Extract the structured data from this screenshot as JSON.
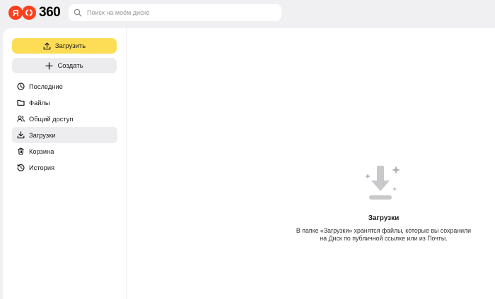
{
  "header": {
    "logo_letter": "Я",
    "logo_text": "360",
    "search_placeholder": "Поиск на моём диске"
  },
  "sidebar": {
    "upload_label": "Загрузить",
    "create_label": "Создать",
    "items": [
      {
        "label": "Последние",
        "icon": "clock-icon"
      },
      {
        "label": "Файлы",
        "icon": "folder-icon"
      },
      {
        "label": "Общий доступ",
        "icon": "shared-users-icon"
      },
      {
        "label": "Загрузки",
        "icon": "download-icon",
        "active": true
      },
      {
        "label": "Корзина",
        "icon": "trash-icon"
      },
      {
        "label": "История",
        "icon": "history-icon"
      }
    ]
  },
  "empty_state": {
    "title": "Загрузки",
    "desc_line1": "В папке «Загрузки» хранятся файлы, которые вы сохранили",
    "desc_line2": "на Диск по публичной ссылке или из Почты."
  },
  "colors": {
    "brand_red": "#fc3f1d",
    "upload_yellow": "#fddd55",
    "page_bg": "#f0f0f2",
    "active_item_bg": "#ededef"
  }
}
